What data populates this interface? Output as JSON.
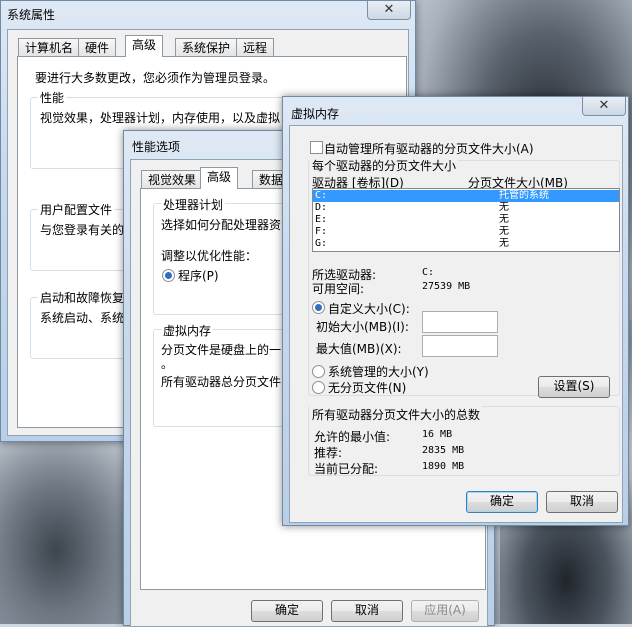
{
  "sysprops": {
    "title": "系统属性",
    "tabs": [
      "计算机名",
      "硬件",
      "高级",
      "系统保护",
      "远程"
    ],
    "admin_note": "要进行大多数更改，您必须作为管理员登录。",
    "perf_label": "性能",
    "perf_desc": "视觉效果，处理器计划，内存使用，以及虚拟",
    "profile_label": "用户配置文件",
    "profile_desc": "与您登录有关的",
    "startup_label": "启动和故障恢复",
    "startup_desc": "系统启动、系统"
  },
  "perfopts": {
    "title": "性能选项",
    "tabs": [
      "视觉效果",
      "高级",
      "数据"
    ],
    "cpu_label": "处理器计划",
    "cpu_desc": "选择如何分配处理器资",
    "optimize_label": "调整以优化性能：",
    "programs_label": "程序(P)",
    "vm_label": "虚拟内存",
    "vm_desc1": "分页文件是硬盘上的一",
    "vm_desc2": "。",
    "vm_total": "所有驱动器总分页文件",
    "ok": "确定",
    "cancel": "取消",
    "apply": "应用(A)"
  },
  "vmem": {
    "title": "虚拟内存",
    "auto_manage": "自动管理所有驱动器的分页文件大小(A)",
    "per_drive_label": "每个驱动器的分页文件大小",
    "col_drive": "驱动器 [卷标](D)",
    "col_size": "分页文件大小(MB)",
    "drives": [
      {
        "drive": "C:",
        "size": "托管的系统"
      },
      {
        "drive": "D:",
        "size": "无"
      },
      {
        "drive": "E:",
        "size": "无"
      },
      {
        "drive": "F:",
        "size": "无"
      },
      {
        "drive": "G:",
        "size": "无"
      }
    ],
    "selected_drive_label": "所选驱动器:",
    "selected_drive_value": "C:",
    "free_space_label": "可用空间:",
    "free_space_value": "27539 MB",
    "custom_size": "自定义大小(C):",
    "initial_size": "初始大小(MB)(I):",
    "max_size": "最大值(MB)(X):",
    "system_managed": "系统管理的大小(Y)",
    "no_paging": "无分页文件(N)",
    "set_button": "设置(S)",
    "total_label": "所有驱动器分页文件大小的总数",
    "min_label": "允许的最小值:",
    "min_value": "16 MB",
    "recommended_label": "推荐:",
    "recommended_value": "2835 MB",
    "current_label": "当前已分配:",
    "current_value": "1890 MB",
    "ok": "确定",
    "cancel": "取消"
  },
  "icons": {
    "close": "✕"
  }
}
